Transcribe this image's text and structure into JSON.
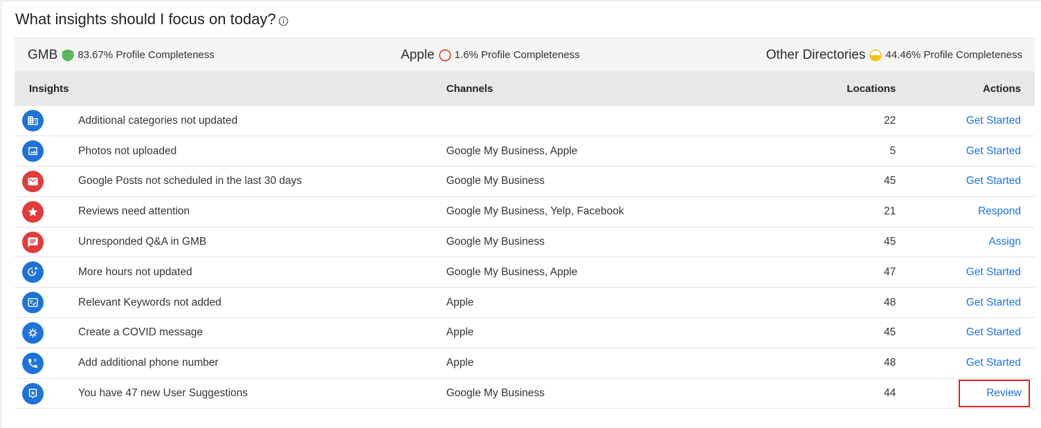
{
  "page": {
    "heading": "What insights should I focus on today?"
  },
  "summary": [
    {
      "name": "GMB",
      "text": "83.67% Profile Completeness",
      "status_color": "#5cb85c"
    },
    {
      "name": "Apple",
      "text": "1.6% Profile Completeness",
      "status_color": "#e0391f"
    },
    {
      "name": "Other Directories",
      "text": "44.46% Profile Completeness",
      "status_color": "#f2c20f"
    }
  ],
  "table": {
    "headers": {
      "insights": "Insights",
      "channels": "Channels",
      "locations": "Locations",
      "actions": "Actions"
    },
    "rows": [
      {
        "icon": "building-icon",
        "insight": "Additional categories not updated",
        "channels": "",
        "locations": "22",
        "action": "Get Started"
      },
      {
        "icon": "photo-icon",
        "insight": "Photos not uploaded",
        "channels": "Google My Business, Apple",
        "locations": "5",
        "action": "Get Started"
      },
      {
        "icon": "mail-icon",
        "insight": "Google Posts not scheduled in the last 30 days",
        "channels": "Google My Business",
        "locations": "45",
        "action": "Get Started"
      },
      {
        "icon": "star-icon",
        "insight": "Reviews need attention",
        "channels": "Google My Business, Yelp, Facebook",
        "locations": "21",
        "action": "Respond"
      },
      {
        "icon": "chat-icon",
        "insight": "Unresponded Q&A in GMB",
        "channels": "Google My Business",
        "locations": "45",
        "action": "Assign"
      },
      {
        "icon": "clock-plus-icon",
        "insight": "More hours not updated",
        "channels": "Google My Business, Apple",
        "locations": "47",
        "action": "Get Started"
      },
      {
        "icon": "checklist-icon",
        "insight": "Relevant Keywords not added",
        "channels": "Apple",
        "locations": "48",
        "action": "Get Started"
      },
      {
        "icon": "virus-icon",
        "insight": "Create a COVID message",
        "channels": "Apple",
        "locations": "45",
        "action": "Get Started"
      },
      {
        "icon": "phone-icon",
        "insight": "Add additional phone number",
        "channels": "Apple",
        "locations": "48",
        "action": "Get Started"
      },
      {
        "icon": "suggestion-icon",
        "insight": "You have 47 new User Suggestions",
        "channels": "Google My Business",
        "locations": "44",
        "action": "Review"
      }
    ]
  },
  "colors": {
    "link": "#1a73e8",
    "icon_blue": "#1e73d8",
    "icon_red": "#e23b3b",
    "highlight": "#e0221f"
  }
}
